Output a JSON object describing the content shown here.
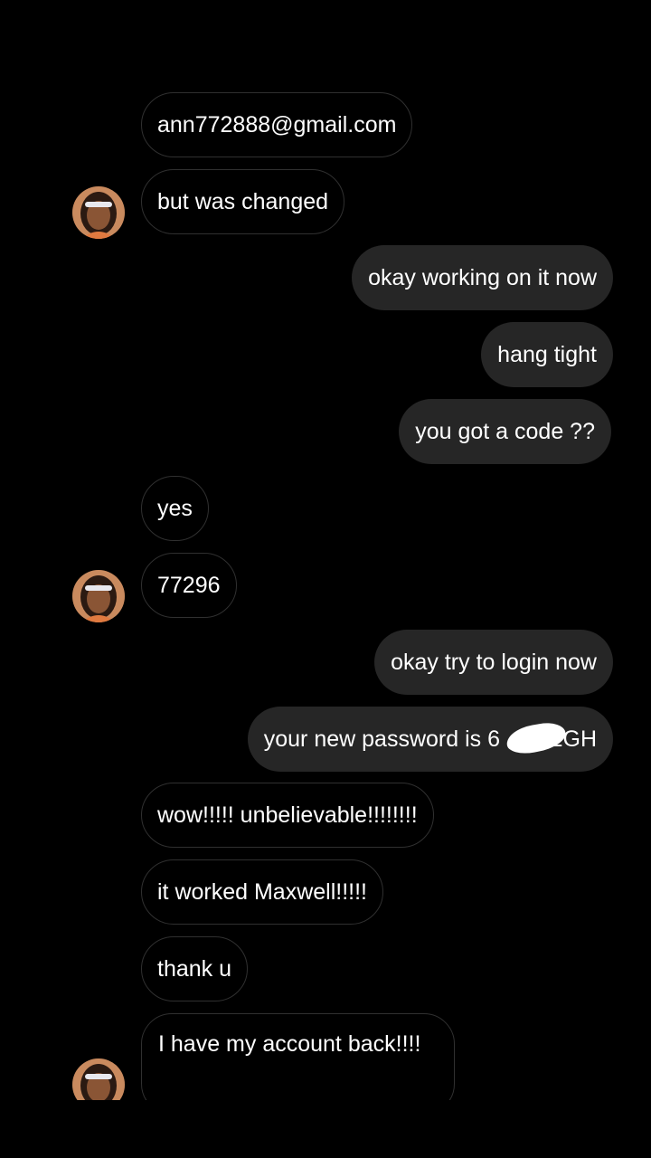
{
  "conversation": {
    "messages": [
      {
        "direction": "incoming",
        "text": "ann772888@gmail.com",
        "avatar": false
      },
      {
        "direction": "incoming",
        "text": "but was changed",
        "avatar": true
      },
      {
        "direction": "outgoing",
        "text": "okay working on it now"
      },
      {
        "direction": "outgoing",
        "text": "hang tight"
      },
      {
        "direction": "outgoing",
        "text": "you got a code ??"
      },
      {
        "direction": "incoming",
        "text": "yes",
        "avatar": false
      },
      {
        "direction": "incoming",
        "text": "77296",
        "avatar": true
      },
      {
        "direction": "outgoing",
        "text": "okay try to login now"
      },
      {
        "direction": "outgoing",
        "text": "your new password is 6    2GH"
      },
      {
        "direction": "incoming",
        "text": "wow!!!!! unbelievable!!!!!!!!",
        "avatar": false
      },
      {
        "direction": "incoming",
        "text": "it worked Maxwell!!!!!",
        "avatar": false
      },
      {
        "direction": "incoming",
        "text": "thank u",
        "avatar": false
      },
      {
        "direction": "incoming",
        "text": " I have my account back!!!!",
        "avatar": true
      }
    ]
  },
  "avatar": {
    "icon": "user-photo-avatar"
  },
  "colors": {
    "background": "#000000",
    "incoming_border": "#303030",
    "outgoing_fill": "#262626",
    "text": "#ffffff"
  }
}
